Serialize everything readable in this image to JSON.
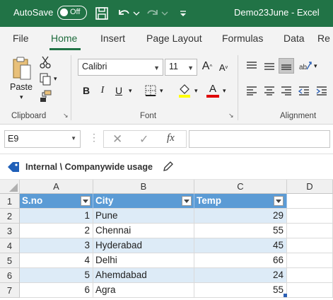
{
  "titlebar": {
    "autosave_label": "AutoSave",
    "autosave_state": "Off",
    "document_title": "Demo23June  -  Excel"
  },
  "tabs": [
    {
      "label": "File"
    },
    {
      "label": "Home"
    },
    {
      "label": "Insert"
    },
    {
      "label": "Page Layout"
    },
    {
      "label": "Formulas"
    },
    {
      "label": "Data"
    },
    {
      "label": "Re"
    }
  ],
  "ribbon": {
    "clipboard": {
      "paste_label": "Paste",
      "group_label": "Clipboard"
    },
    "font": {
      "family": "Calibri",
      "size": "11",
      "group_label": "Font",
      "bold": "B",
      "italic": "I",
      "underline": "U",
      "grow": "A",
      "shrink": "A"
    },
    "alignment": {
      "group_label": "Alignment"
    }
  },
  "formula_bar": {
    "name_box": "E9",
    "fx_label": "fx",
    "content": ""
  },
  "sensitivity": {
    "label": "Internal \\ Companywide usage"
  },
  "sheet": {
    "columns": [
      "A",
      "B",
      "C",
      "D"
    ],
    "rows": [
      "1",
      "2",
      "3",
      "4",
      "5",
      "6",
      "7"
    ],
    "headers": [
      "S.no",
      "City",
      "Temp"
    ],
    "data": [
      {
        "sno": "1",
        "city": "Pune",
        "temp": "29"
      },
      {
        "sno": "2",
        "city": "Chennai",
        "temp": "55"
      },
      {
        "sno": "3",
        "city": "Hyderabad",
        "temp": "45"
      },
      {
        "sno": "4",
        "city": "Delhi",
        "temp": "66"
      },
      {
        "sno": "5",
        "city": "Ahemdabad",
        "temp": "24"
      },
      {
        "sno": "6",
        "city": "Agra",
        "temp": "55"
      }
    ]
  },
  "colors": {
    "excel_green": "#217346",
    "table_header": "#5b9bd5",
    "table_band": "#ddebf7",
    "font_color_red": "#e00000",
    "highlight_yellow": "#ffff00"
  }
}
